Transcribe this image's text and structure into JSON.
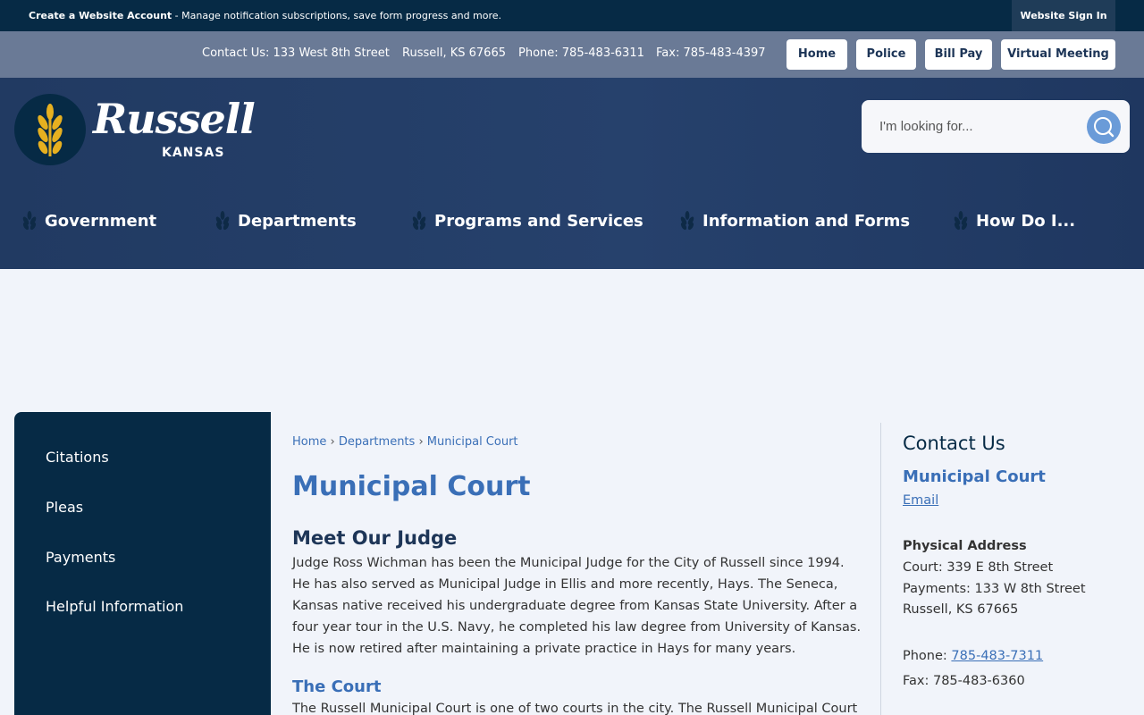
{
  "topbar": {
    "account_link": "Create a Website Account",
    "account_desc": " - Manage notification subscriptions, save form progress and more.",
    "sign_in": "Website Sign In"
  },
  "contact_bar": {
    "contact": "Contact Us: 133 West 8th Street",
    "city": "Russell, KS 67665",
    "phone": "Phone: 785-483-6311",
    "fax": "Fax: 785-483-4397",
    "buttons": [
      "Home",
      "Police",
      "Bill Pay",
      "Virtual Meeting"
    ]
  },
  "logo": {
    "name": "Russell",
    "state": "KANSAS"
  },
  "search": {
    "placeholder": "I'm looking for..."
  },
  "nav": [
    "Government",
    "Departments",
    "Programs and Services",
    "Information and Forms",
    "How Do I..."
  ],
  "sidebar": [
    "Citations",
    "Pleas",
    "Payments",
    "Helpful Information"
  ],
  "breadcrumb": {
    "home": "Home",
    "sep": " › ",
    "departments": "Departments",
    "current": "Municipal Court"
  },
  "main": {
    "title": "Municipal Court",
    "judge_heading": "Meet Our Judge",
    "judge_text": "Judge Ross Wichman has been the Municipal Judge for the City of Russell since 1994. He has also served as Municipal Judge in Ellis and more recently, Hays. The Seneca, Kansas native received his undergraduate degree from Kansas State University. After a four year tour in the U.S. Navy, he completed his law degree from University of Kansas. He is now retired after maintaining a private practice in Hays for many years.",
    "court_heading": "The Court",
    "court_text": "The Russell Municipal Court is one of two courts in the city. The Russell Municipal Court"
  },
  "contact_rail": {
    "heading": "Contact Us",
    "department": "Municipal Court",
    "email": "Email",
    "address_label": "Physical Address",
    "address_lines": [
      "Court: 339 E 8th Street",
      "Payments: 133 W 8th Street",
      "Russell, KS 67665"
    ],
    "phone_label": "Phone: ",
    "phone": "785-483-7311",
    "fax": "Fax: 785-483-6360"
  },
  "colors": {
    "dark_navy": "#062a45",
    "header_blue": "#26416c",
    "link_blue": "#3a6fb7",
    "wheat_gold": "#e6b020"
  }
}
